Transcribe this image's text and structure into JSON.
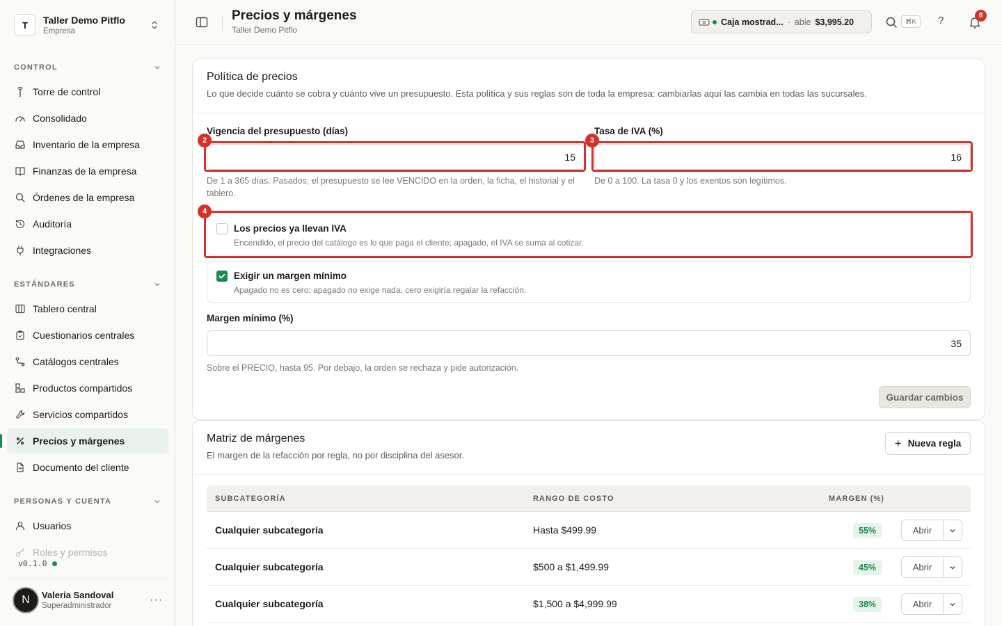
{
  "org": {
    "initial": "T",
    "name": "Taller Demo Pitflo",
    "type": "Empresa"
  },
  "sidebar": {
    "sections": [
      {
        "label": "CONTROL",
        "items": [
          {
            "label": "Torre de control",
            "icon": "tower-icon"
          },
          {
            "label": "Consolidado",
            "icon": "gauge-icon"
          },
          {
            "label": "Inventario de la empresa",
            "icon": "inbox-icon"
          },
          {
            "label": "Finanzas de la empresa",
            "icon": "book-icon"
          },
          {
            "label": "Órdenes de la empresa",
            "icon": "search-icon"
          },
          {
            "label": "Auditoría",
            "icon": "history-icon"
          },
          {
            "label": "Integraciones",
            "icon": "plug-icon"
          }
        ]
      },
      {
        "label": "ESTÁNDARES",
        "items": [
          {
            "label": "Tablero central",
            "icon": "columns-icon"
          },
          {
            "label": "Cuestionarios centrales",
            "icon": "clipboard-icon"
          },
          {
            "label": "Catálogos centrales",
            "icon": "route-icon"
          },
          {
            "label": "Productos compartidos",
            "icon": "boxes-icon"
          },
          {
            "label": "Servicios compartidos",
            "icon": "wrench-icon"
          },
          {
            "label": "Precios y márgenes",
            "icon": "percent-icon",
            "active": true
          },
          {
            "label": "Documento del cliente",
            "icon": "document-icon"
          }
        ]
      },
      {
        "label": "PERSONAS Y CUENTA",
        "items": [
          {
            "label": "Usuarios",
            "icon": "user-icon"
          },
          {
            "label": "Roles y permisos",
            "icon": "key-icon",
            "faded": true
          }
        ]
      }
    ]
  },
  "version": "v0.1.0",
  "user": {
    "initial": "N",
    "name": "Valeria Sandoval",
    "role": "Superadministrador",
    "more": "···"
  },
  "header": {
    "title": "Precios y márgenes",
    "subtitle": "Taller Demo Pitflo",
    "cash_name": "Caja mostrad...",
    "cash_sep": "·",
    "cash_status": "abie",
    "cash_amount": "$3,995.20",
    "kbd": "⌘K",
    "help": "?",
    "notifications": "8"
  },
  "policy": {
    "title": "Política de precios",
    "description": "Lo que decide cuánto se cobra y cuánto vive un presupuesto. Esta política y sus reglas son de toda la empresa: cambiarlas aquí las cambia en todas las sucursales.",
    "validity_label": "Vigencia del presupuesto (días)",
    "validity_value": "15",
    "validity_hint": "De 1 a 365 días. Pasados, el presupuesto se lee VENCIDO en la orden, la ficha, el historial y el tablero.",
    "iva_label": "Tasa de IVA (%)",
    "iva_value": "16",
    "iva_hint": "De 0 a 100. La tasa 0 y los exentos son legítimos.",
    "prices_include_iva": {
      "title": "Los precios ya llevan IVA",
      "description": "Encendido, el precio del catálogo es lo que paga el cliente; apagado, el IVA se suma al cotizar.",
      "checked": false
    },
    "require_margin": {
      "title": "Exigir un margen mínimo",
      "description": "Apagado no es cero: apagado no exige nada, cero exigiría regalar la refacción.",
      "checked": true
    },
    "min_margin_label": "Margen mínimo (%)",
    "min_margin_value": "35",
    "min_margin_hint": "Sobre el PRECIO, hasta 95. Por debajo, la orden se rechaza y pide autorización.",
    "save_label": "Guardar cambios"
  },
  "annotations": {
    "a2": "2",
    "a3": "3",
    "a4": "4"
  },
  "matrix": {
    "title": "Matriz de márgenes",
    "description": "El margen de la refacción por regla, no por disciplina del asesor.",
    "new_rule_label": "Nueva regla",
    "columns": {
      "subcategory": "SUBCATEGORÍA",
      "cost_range": "RANGO DE COSTO",
      "margin": "MARGEN (%)"
    },
    "open_label": "Abrir",
    "rows": [
      {
        "subcategory": "Cualquier subcategoría",
        "range": "Hasta $499.99",
        "margin": "55%"
      },
      {
        "subcategory": "Cualquier subcategoría",
        "range": "$500 a $1,499.99",
        "margin": "45%"
      },
      {
        "subcategory": "Cualquier subcategoría",
        "range": "$1,500 a $4,999.99",
        "margin": "38%"
      }
    ]
  }
}
